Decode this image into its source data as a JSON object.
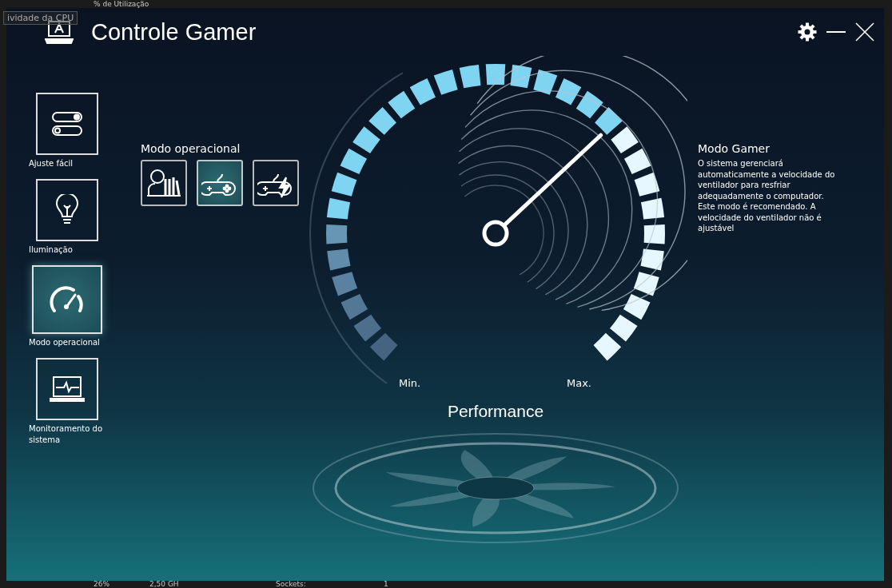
{
  "backdrop": {
    "top_text": "% de Utilização",
    "tooltip": "ividade da CPU",
    "bottom_texts": [
      "26%",
      "2,50 GH",
      "Sockets:",
      "1"
    ]
  },
  "window": {
    "title": "Controle Gamer"
  },
  "sidebar": {
    "items": [
      {
        "label": "Ajuste fácil",
        "kind": "toggles",
        "selected": false
      },
      {
        "label": "Iluminação",
        "kind": "bulb",
        "selected": false
      },
      {
        "label": "Modo operacional",
        "kind": "gauge",
        "selected": true
      },
      {
        "label": "Monitoramento do sistema",
        "kind": "monitor",
        "selected": false
      }
    ]
  },
  "modes": {
    "title": "Modo operacional",
    "options": [
      {
        "kind": "study",
        "selected": false
      },
      {
        "kind": "gamepad",
        "selected": true
      },
      {
        "kind": "turbo",
        "selected": false
      }
    ]
  },
  "gauge": {
    "min_label": "Min.",
    "max_label": "Max.",
    "caption": "Performance"
  },
  "info": {
    "title": "Modo Gamer",
    "text": "O sistema gerenciará automaticamente a velocidade do ventilador para resfriar adequadamente o computador. Este modo é recomendado. A velocidade do ventilador não é ajustável"
  }
}
